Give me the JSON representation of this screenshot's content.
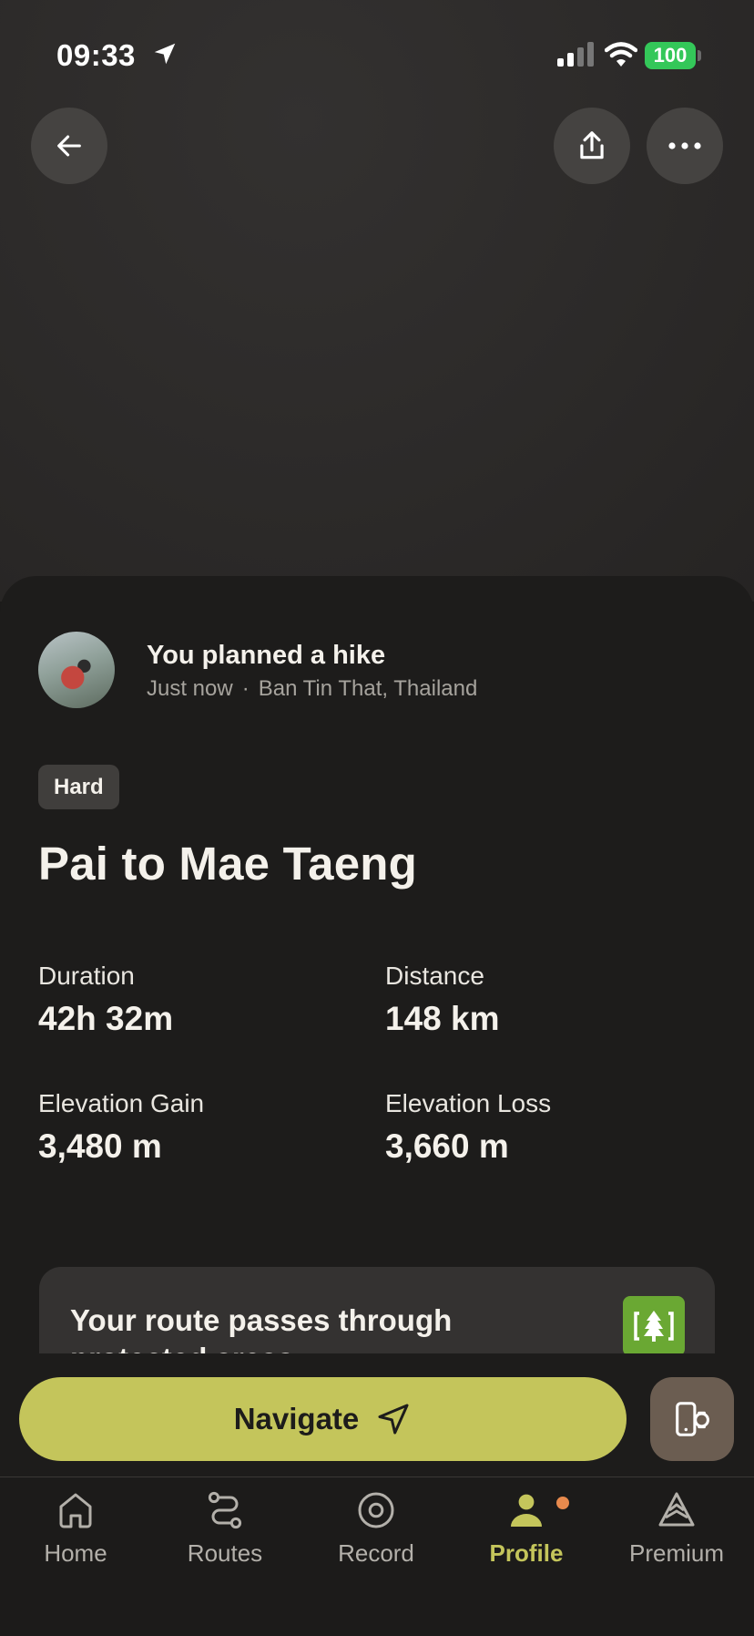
{
  "status_bar": {
    "time": "09:33",
    "battery": "100",
    "battery_color": "#34c759"
  },
  "header": {
    "back_icon": "arrow-left-icon",
    "share_icon": "share-icon",
    "more_icon": "more-horizontal-icon"
  },
  "activity": {
    "title": "You planned a hike",
    "time": "Just now",
    "separator": "·",
    "location": "Ban Tin That, Thailand"
  },
  "route": {
    "difficulty": "Hard",
    "name": "Pai to Mae Taeng"
  },
  "stats": {
    "duration": {
      "label": "Duration",
      "value": "42h 32m"
    },
    "distance": {
      "label": "Distance",
      "value": "148 km"
    },
    "elevation_gain": {
      "label": "Elevation Gain",
      "value": "3,480 m"
    },
    "elevation_loss": {
      "label": "Elevation Loss",
      "value": "3,660 m"
    }
  },
  "notice": {
    "text": "Your route passes through protected areas",
    "icon": "protected-area-icon",
    "icon_color": "#6aa833"
  },
  "actions": {
    "navigate_label": "Navigate",
    "accent_color": "#c4c55b",
    "watch_icon": "watch-sync-icon"
  },
  "tabs": [
    {
      "label": "Home",
      "icon": "home-icon"
    },
    {
      "label": "Routes",
      "icon": "routes-icon"
    },
    {
      "label": "Record",
      "icon": "record-icon"
    },
    {
      "label": "Profile",
      "icon": "profile-icon",
      "active": true
    },
    {
      "label": "Premium",
      "icon": "premium-icon"
    }
  ]
}
